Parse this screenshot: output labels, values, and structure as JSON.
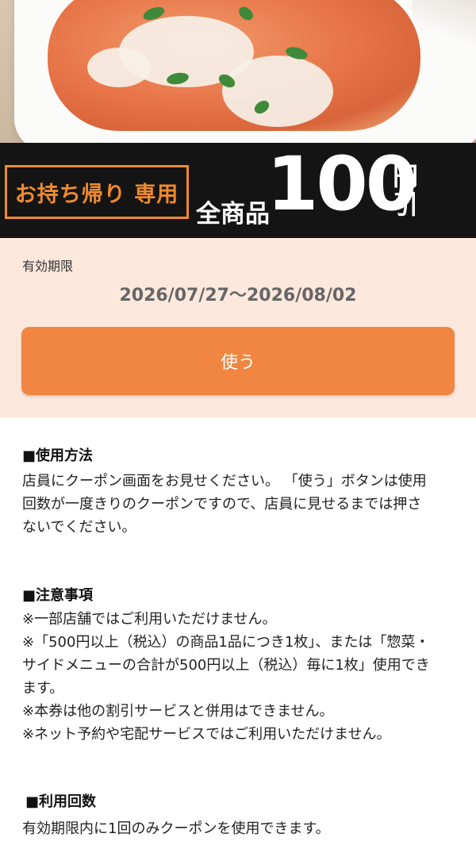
{
  "hero": {
    "image": "chicken-katsu-bowl-photo"
  },
  "banner": {
    "takeout_label": "お持ち帰り 専用",
    "all_items": "全商品",
    "amount": "100",
    "yen": "円",
    "discount": "引"
  },
  "validity": {
    "label": "有効期限",
    "range": "2026/07/27〜2026/08/02"
  },
  "use_button": {
    "label": "使う"
  },
  "usage": {
    "title": "■使用方法",
    "lines": [
      "店員にクーポン画面をお見せください。 「使う」ボタンは使用",
      "回数が一度きりのクーポンですので、店員に見せるまでは押さ",
      "ないでください。"
    ]
  },
  "notes": {
    "title": "■注意事項",
    "lines": [
      "※一部店舗ではご利用いただけません。",
      "※「500円以上（税込）の商品1品につき1枚」、または「惣菜・",
      "サイドメニューの合計が500円以上（税込）毎に1枚」使用でき",
      "ます。",
      "※本券は他の割引サービスと併用はできません。",
      "※ネット予約や宅配サービスではご利用いただけません。"
    ]
  },
  "count": {
    "title": "■利用回数",
    "lines": [
      "有効期限内に1回のみクーポンを使用できます。"
    ]
  },
  "colors": {
    "accent": "#f08642",
    "takeout_orange": "#ef8a2d",
    "panel_bg": "#fde8dd",
    "banner_bg": "#141414"
  }
}
